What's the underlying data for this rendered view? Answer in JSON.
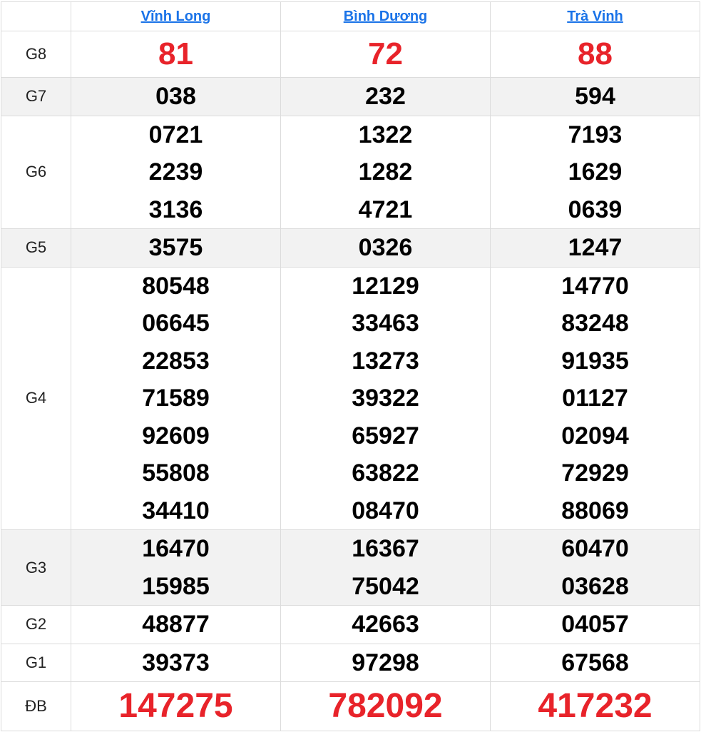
{
  "provinces": [
    "Vĩnh Long",
    "Bình Dương",
    "Trà Vinh"
  ],
  "colors": {
    "link": "#1a73e8",
    "highlight": "#e8232a",
    "alt_row": "#f2f2f2",
    "border": "#dcdcdc"
  },
  "prizes": [
    {
      "label": "G8",
      "values": [
        [
          "81"
        ],
        [
          "72"
        ],
        [
          "88"
        ]
      ]
    },
    {
      "label": "G7",
      "values": [
        [
          "038"
        ],
        [
          "232"
        ],
        [
          "594"
        ]
      ]
    },
    {
      "label": "G6",
      "values": [
        [
          "0721",
          "2239",
          "3136"
        ],
        [
          "1322",
          "1282",
          "4721"
        ],
        [
          "7193",
          "1629",
          "0639"
        ]
      ]
    },
    {
      "label": "G5",
      "values": [
        [
          "3575"
        ],
        [
          "0326"
        ],
        [
          "1247"
        ]
      ]
    },
    {
      "label": "G4",
      "values": [
        [
          "80548",
          "06645",
          "22853",
          "71589",
          "92609",
          "55808",
          "34410"
        ],
        [
          "12129",
          "33463",
          "13273",
          "39322",
          "65927",
          "63822",
          "08470"
        ],
        [
          "14770",
          "83248",
          "91935",
          "01127",
          "02094",
          "72929",
          "88069"
        ]
      ]
    },
    {
      "label": "G3",
      "values": [
        [
          "16470",
          "15985"
        ],
        [
          "16367",
          "75042"
        ],
        [
          "60470",
          "03628"
        ]
      ]
    },
    {
      "label": "G2",
      "values": [
        [
          "48877"
        ],
        [
          "42663"
        ],
        [
          "04057"
        ]
      ]
    },
    {
      "label": "G1",
      "values": [
        [
          "39373"
        ],
        [
          "97298"
        ],
        [
          "67568"
        ]
      ]
    },
    {
      "label": "ĐB",
      "values": [
        [
          "147275"
        ],
        [
          "782092"
        ],
        [
          "417232"
        ]
      ]
    }
  ]
}
